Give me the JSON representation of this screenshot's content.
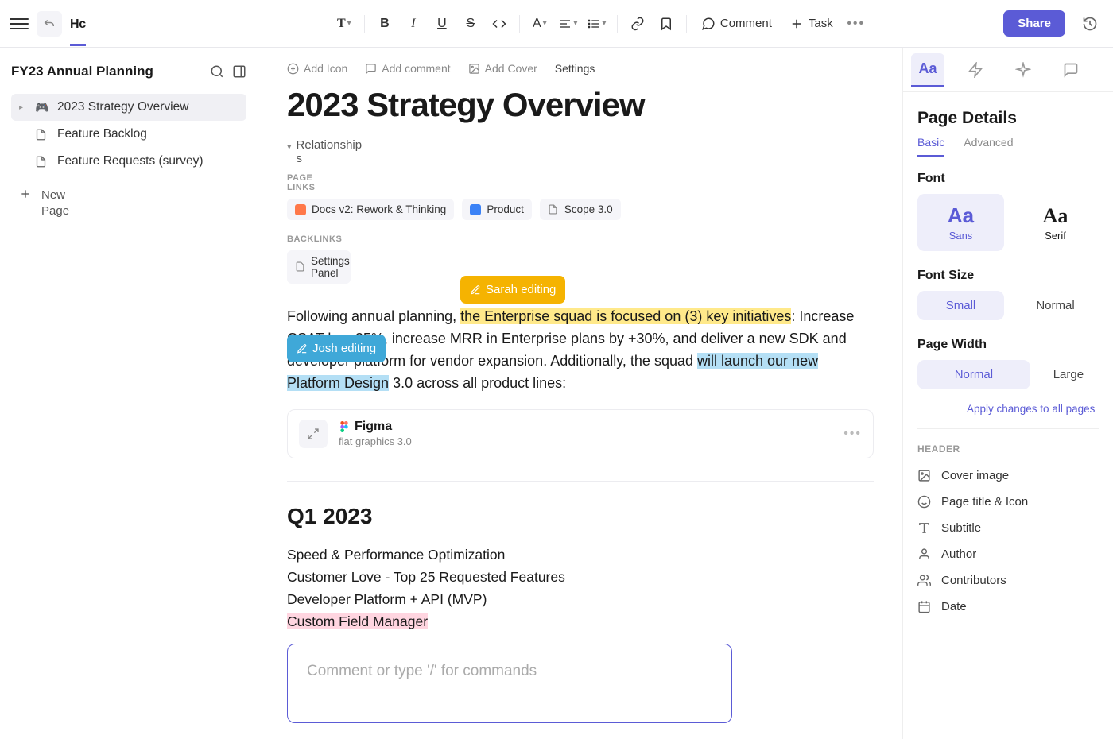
{
  "toolbar": {
    "brand": "Hc",
    "comment": "Comment",
    "task": "Task",
    "share": "Share"
  },
  "sidebar": {
    "title": "FY23 Annual Planning",
    "items": [
      {
        "label": "2023 Strategy Overview"
      },
      {
        "label": "Feature Backlog"
      },
      {
        "label": "Feature Requests (survey)"
      }
    ],
    "new_page": "New Page"
  },
  "doc": {
    "actions": {
      "add_icon": "Add Icon",
      "add_comment": "Add comment",
      "add_cover": "Add Cover",
      "settings": "Settings"
    },
    "title": "2023 Strategy Overview",
    "relationships": "Relationships",
    "page_links_label": "PAGE LINKS",
    "links": [
      {
        "label": "Docs v2: Rework & Thinking"
      },
      {
        "label": "Product"
      },
      {
        "label": "Scope 3.0"
      }
    ],
    "backlinks_label": "BACKLINKS",
    "backlinks": [
      {
        "label": "Settings Panel"
      }
    ],
    "presence": {
      "sarah": "Sarah editing",
      "josh": "Josh editing"
    },
    "body": {
      "p1_a": "Following annual planning, ",
      "p1_hl1": "the Enterprise squad is focused on (3) key initiatives",
      "p1_b": ": Increase CSAT by +25%, increase MRR in Enterprise plans by +30%, and deliver ",
      "p1_c": "a new SDK",
      "p1_d": " and developer platform for vendor expansion. Additionally, the squad ",
      "p1_hl2": "will launch our new Platform Design",
      "p1_e": " 3.0 across all product lines:"
    },
    "embed": {
      "title": "Figma",
      "subtitle": "flat graphics 3.0"
    },
    "q1_heading": "Q1 2023",
    "q1_items": [
      "Speed & Performance Optimization",
      "Customer Love - Top 25 Requested Features",
      "Developer Platform + API (MVP)",
      "Custom Field Manager"
    ],
    "comment_placeholder": "Comment or type '/' for commands"
  },
  "rightpanel": {
    "title": "Page Details",
    "tabs": {
      "basic": "Basic",
      "advanced": "Advanced"
    },
    "font_label": "Font",
    "font_sans": "Sans",
    "font_serif": "Serif",
    "fontsize_label": "Font Size",
    "size_small": "Small",
    "size_normal": "Normal",
    "width_label": "Page Width",
    "width_normal": "Normal",
    "width_large": "Large",
    "apply": "Apply changes to all pages",
    "header_label": "HEADER",
    "header_items": [
      "Cover image",
      "Page title & Icon",
      "Subtitle",
      "Author",
      "Contributors",
      "Date"
    ]
  }
}
